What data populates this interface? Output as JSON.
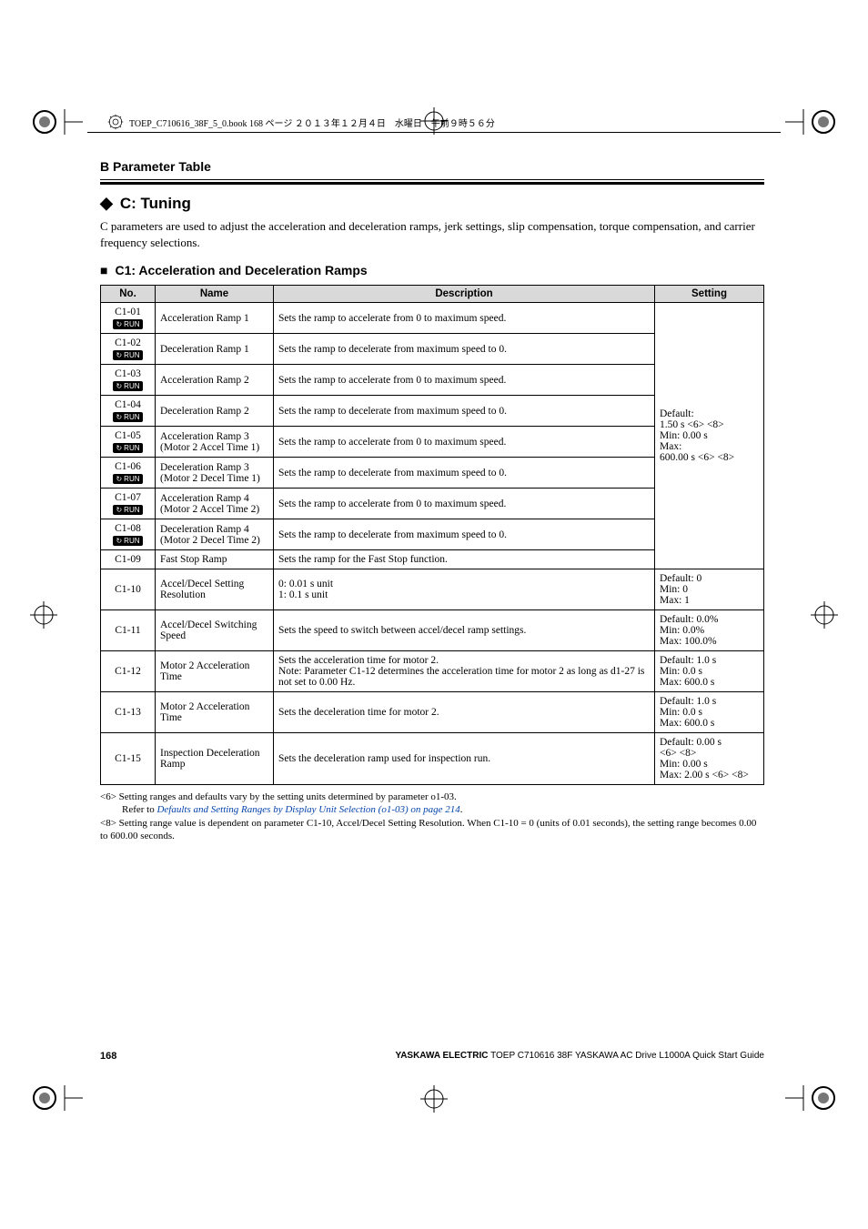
{
  "book_header": "TOEP_C710616_38F_5_0.book  168 ページ  ２０１３年１２月４日　水曜日　午前９時５６分",
  "section_label": "B  Parameter Table",
  "h2": "C: Tuning",
  "intro": "C parameters are used to adjust the acceleration and deceleration ramps, jerk settings, slip compensation, torque compensation, and carrier frequency selections.",
  "h3": "C1: Acceleration and Deceleration Ramps",
  "headers": {
    "no": "No.",
    "name": "Name",
    "desc": "Description",
    "setting": "Setting"
  },
  "rows": [
    {
      "no": "C1-01",
      "run": true,
      "name": "Acceleration Ramp 1",
      "desc": "Sets the ramp to accelerate from 0 to maximum speed."
    },
    {
      "no": "C1-02",
      "run": true,
      "name": "Deceleration Ramp 1",
      "desc": "Sets the ramp to decelerate from maximum speed to 0."
    },
    {
      "no": "C1-03",
      "run": true,
      "name": "Acceleration Ramp 2",
      "desc": "Sets the ramp to accelerate from 0 to maximum speed."
    },
    {
      "no": "C1-04",
      "run": true,
      "name": "Deceleration Ramp 2",
      "desc": "Sets the ramp to decelerate from maximum speed to 0."
    },
    {
      "no": "C1-05",
      "run": true,
      "name": "Acceleration Ramp 3 (Motor 2 Accel Time 1)",
      "desc": "Sets the ramp to accelerate from 0 to maximum speed."
    },
    {
      "no": "C1-06",
      "run": true,
      "name": "Deceleration Ramp 3 (Motor 2 Decel Time 1)",
      "desc": "Sets the ramp to decelerate from maximum speed to 0."
    },
    {
      "no": "C1-07",
      "run": true,
      "name": "Acceleration Ramp 4 (Motor 2 Accel Time 2)",
      "desc": "Sets the ramp to accelerate from 0 to maximum speed."
    },
    {
      "no": "C1-08",
      "run": true,
      "name": "Deceleration Ramp 4 (Motor 2 Decel Time 2)",
      "desc": "Sets the ramp to decelerate from maximum speed to 0."
    }
  ],
  "group_setting": "Default:\n1.50 s <6> <8>\nMin: 0.00 s\nMax:\n600.00 s <6> <8>",
  "rows2": [
    {
      "no": "C1-09",
      "name": "Fast Stop Ramp",
      "desc": "Sets the ramp for the Fast Stop function.",
      "setting_merge": true
    },
    {
      "no": "C1-10",
      "name": "Accel/Decel Setting Resolution",
      "desc": "0: 0.01 s unit\n1: 0.1 s unit",
      "setting": "Default: 0\nMin: 0\nMax: 1"
    },
    {
      "no": "C1-11",
      "name": "Accel/Decel Switching Speed",
      "desc": "Sets the speed to switch between accel/decel ramp settings.",
      "setting": "Default: 0.0%\nMin: 0.0%\nMax: 100.0%"
    },
    {
      "no": "C1-12",
      "name": "Motor 2 Acceleration Time",
      "desc": "Sets the acceleration time for motor 2.\nNote: Parameter C1-12 determines the acceleration time for motor 2 as long as d1-27 is not set to 0.00 Hz.",
      "setting": "Default: 1.0 s\nMin: 0.0 s\nMax: 600.0 s"
    },
    {
      "no": "C1-13",
      "name": "Motor 2 Acceleration Time",
      "desc": "Sets the deceleration time for motor 2.",
      "setting": "Default: 1.0 s\nMin: 0.0 s\nMax: 600.0 s"
    },
    {
      "no": "C1-15",
      "name": "Inspection Deceleration Ramp",
      "desc": "Sets the deceleration ramp used for inspection run.",
      "setting": "Default: 0.00 s\n<6> <8>\nMin: 0.00 s\nMax: 2.00 s <6> <8>"
    }
  ],
  "footnotes": {
    "n6a": "<6> Setting ranges and defaults vary by the setting units determined by parameter o1-03.",
    "n6b_pre": "Refer to ",
    "n6b_link": "Defaults and Setting Ranges by Display Unit Selection (o1-03) on page 214",
    "n6b_post": ".",
    "n8": "<8> Setting range value is dependent on parameter C1-10, Accel/Decel Setting Resolution. When C1-10 = 0 (units of 0.01 seconds), the setting range becomes 0.00 to 600.00 seconds."
  },
  "footer": {
    "page": "168",
    "right_bold": "YASKAWA ELECTRIC",
    "right_rest": " TOEP C710616 38F YASKAWA AC Drive L1000A Quick Start Guide"
  }
}
